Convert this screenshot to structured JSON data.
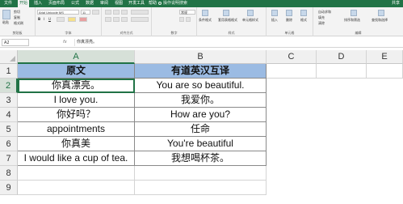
{
  "tabs": [
    "文件",
    "开始",
    "插入",
    "页面布局",
    "公式",
    "数据",
    "审阅",
    "视图",
    "开发工具",
    "帮助"
  ],
  "active_tab": "开始",
  "tell_me": "操作说明搜索",
  "share": "共享",
  "ribbon": {
    "paste": "粘贴",
    "cut": "剪切",
    "copy": "复制",
    "format_painter": "格式刷",
    "font_name": "Arial Unicode MS",
    "font_size": "11",
    "number_format": "常规",
    "insert": "插入",
    "delete": "删除",
    "format": "格式",
    "autosum": "自动求和",
    "fill": "填充",
    "clear": "清除",
    "sort_filter": "排序和筛选",
    "find_select": "查找和选择",
    "cond_format": "条件格式",
    "table_format": "套用表格格式",
    "cell_styles": "单元格样式",
    "groups": {
      "clipboard": "剪贴板",
      "font": "字体",
      "alignment": "对齐方式",
      "number": "数字",
      "styles": "样式",
      "cells": "单元格",
      "editing": "编辑"
    }
  },
  "namebox": "A2",
  "fx": "fx",
  "formula": "你真漂亮。",
  "columns": [
    "A",
    "B",
    "C",
    "D",
    "E"
  ],
  "rows": [
    "1",
    "2",
    "3",
    "4",
    "5",
    "6",
    "7",
    "8",
    "9"
  ],
  "table": {
    "header": [
      "原文",
      "有道英汉互译"
    ],
    "rows": [
      [
        "你真漂亮。",
        "You are so beautiful."
      ],
      [
        "I love you.",
        "我爱你。"
      ],
      [
        "你好吗？",
        "How are you?"
      ],
      [
        "appointments",
        "任命"
      ],
      [
        "你真美",
        "You're beautiful"
      ],
      [
        "I would like a cup of tea.",
        "我想喝杯茶。"
      ]
    ]
  },
  "colors": {
    "brand": "#217346",
    "header_fill": "#9bbbe3"
  }
}
